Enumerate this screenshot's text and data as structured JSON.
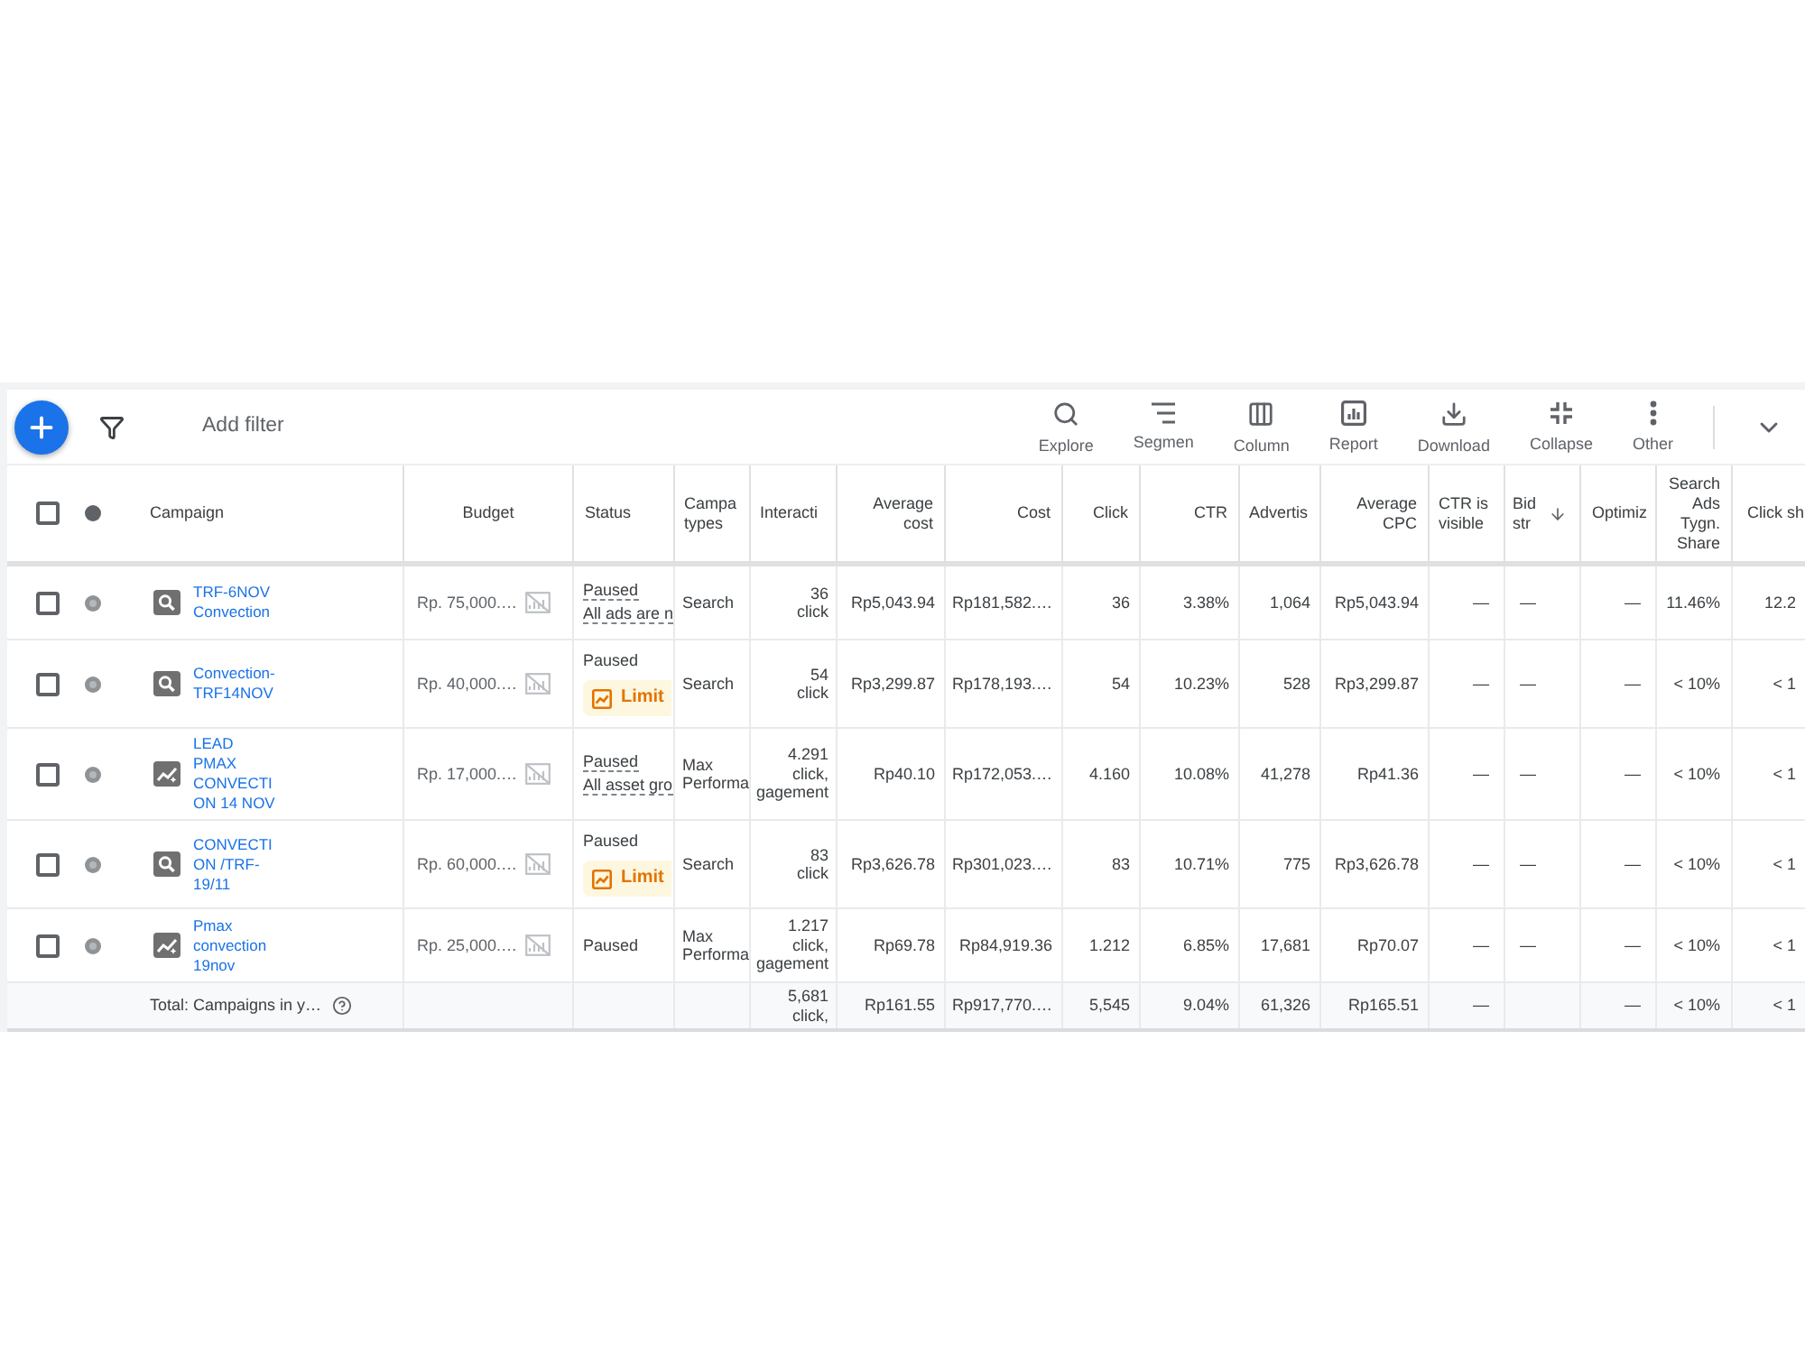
{
  "toolbar": {
    "filter": {
      "placeholder": "Add filter"
    },
    "actions": [
      {
        "kind": "explore",
        "label": "Explore"
      },
      {
        "kind": "segment",
        "label": "Segmen"
      },
      {
        "kind": "columns",
        "label": "Column"
      },
      {
        "kind": "report",
        "label": "Report"
      },
      {
        "kind": "download",
        "label": "Download"
      },
      {
        "kind": "collapse",
        "label": "Collapse"
      },
      {
        "kind": "more",
        "label": "Other"
      }
    ]
  },
  "table": {
    "select_all": {
      "checked": false
    },
    "columns": [
      {
        "label": "Campaign",
        "kind": "campaign"
      },
      {
        "label": "Budget",
        "kind": "budget"
      },
      {
        "label": "Status",
        "kind": "status"
      },
      {
        "label": "Campa types",
        "kind": "text"
      },
      {
        "label": "Interacti",
        "kind": "interactions"
      },
      {
        "label": "Average cost",
        "kind": "metric"
      },
      {
        "label": "Cost",
        "kind": "metric"
      },
      {
        "label": "Click",
        "kind": "metric"
      },
      {
        "label": "CTR",
        "kind": "metric"
      },
      {
        "label": "Advertis",
        "kind": "metric"
      },
      {
        "label": "Average CPC",
        "kind": "metric"
      },
      {
        "label": "CTR is visible",
        "kind": "metric"
      },
      {
        "label": "Bid str",
        "kind": "metric",
        "sorted": true
      },
      {
        "label": "Optimiz",
        "kind": "metric"
      },
      {
        "label": "Search Ads Tygn. Share",
        "kind": "metric"
      },
      {
        "label": "Click sh",
        "kind": "metric"
      }
    ],
    "rows": [
      {
        "checked": false,
        "cells": [
          {
            "kind": "search",
            "name": "TRF-6NOV Convection"
          },
          "Rp. 75,000.…",
          {
            "label": "Paused",
            "dotted": true,
            "note": "All ads are n"
          },
          "Search",
          {
            "value": "36",
            "type": "click"
          },
          "Rp5,043.94",
          "Rp181,582.…",
          "36",
          "3.38%",
          "1,064",
          "Rp5,043.94",
          "—",
          "—",
          "—",
          "11.46%",
          "12.2"
        ]
      },
      {
        "checked": false,
        "cells": [
          {
            "kind": "search",
            "name": "Convection-TRF14NOV"
          },
          "Rp. 40,000.…",
          {
            "label": "Paused",
            "dotted": false,
            "badge": "Limit"
          },
          "Search",
          {
            "value": "54",
            "type": "click"
          },
          "Rp3,299.87",
          "Rp178,193.…",
          "54",
          "10.23%",
          "528",
          "Rp3,299.87",
          "—",
          "—",
          "—",
          "< 10%",
          "< 1"
        ]
      },
      {
        "checked": false,
        "cells": [
          {
            "kind": "pmax",
            "name": "LEAD PMAX CONVECTION 14 NOV"
          },
          "Rp. 17,000.…",
          {
            "label": "Paused",
            "dotted": true,
            "note": "All asset gro"
          },
          "Max Performa",
          {
            "value": "4.291",
            "type": "click, gagement"
          },
          "Rp40.10",
          "Rp172,053.…",
          "4.160",
          "10.08%",
          "41,278",
          "Rp41.36",
          "—",
          "—",
          "—",
          "< 10%",
          "< 1"
        ]
      },
      {
        "checked": false,
        "cells": [
          {
            "kind": "search",
            "name": "CONVECTION /TRF-19/11"
          },
          "Rp. 60,000.…",
          {
            "label": "Paused",
            "dotted": false,
            "badge": "Limit"
          },
          "Search",
          {
            "value": "83",
            "type": "click"
          },
          "Rp3,626.78",
          "Rp301,023.…",
          "83",
          "10.71%",
          "775",
          "Rp3,626.78",
          "—",
          "—",
          "—",
          "< 10%",
          "< 1"
        ]
      },
      {
        "checked": false,
        "cells": [
          {
            "kind": "pmax",
            "name": "Pmax convection 19nov"
          },
          "Rp. 25,000.…",
          {
            "label": "Paused",
            "dotted": false
          },
          "Max Performa",
          {
            "value": "1.217",
            "type": "click, gagement"
          },
          "Rp69.78",
          "Rp84,919.36",
          "1.212",
          "6.85%",
          "17,681",
          "Rp70.07",
          "—",
          "—",
          "—",
          "< 10%",
          "< 1"
        ]
      }
    ],
    "total": {
      "cells": [
        {
          "label": "Total: Campaigns in y…"
        },
        "",
        "",
        "",
        {
          "value": "5,681",
          "type": "click,"
        },
        "Rp161.55",
        "Rp917,770.…",
        "5,545",
        "9.04%",
        "61,326",
        "Rp165.51",
        "—",
        "",
        "—",
        "< 10%",
        "< 1"
      ]
    }
  }
}
